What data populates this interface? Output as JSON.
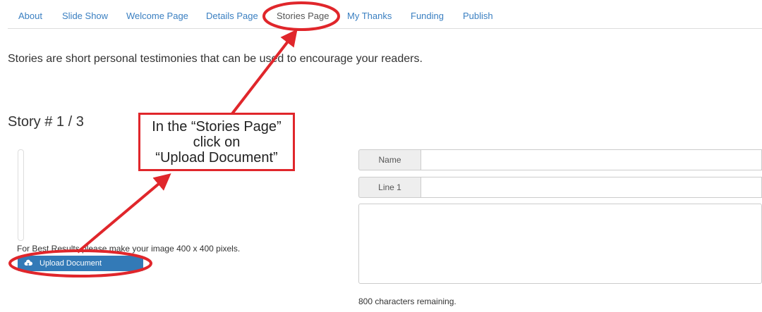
{
  "nav": {
    "tabs": [
      {
        "label": "About"
      },
      {
        "label": "Slide Show"
      },
      {
        "label": "Welcome Page"
      },
      {
        "label": "Details Page"
      },
      {
        "label": "Stories Page"
      },
      {
        "label": "My Thanks"
      },
      {
        "label": "Funding"
      },
      {
        "label": "Publish"
      }
    ],
    "active_tab": "Stories Page"
  },
  "intro_text": "Stories are short personal testimonies that can be used to encourage your readers.",
  "story_heading": "Story # 1 / 3",
  "image_hint": "For Best Results please make your image 400 x 400 pixels.",
  "upload_button": {
    "label": "Upload Document",
    "icon": "cloud-upload-icon"
  },
  "form": {
    "name_label": "Name",
    "name_value": "",
    "line1_label": "Line 1",
    "line1_value": "",
    "story_value": "",
    "remaining_text": "800 characters remaining."
  },
  "annotation": {
    "callout_text": "In the “Stories Page”\nclick on\n“Upload Document”"
  },
  "colors": {
    "link": "#3a7fc1",
    "primary_button": "#337ab7",
    "annotation_red": "#e0262b"
  }
}
